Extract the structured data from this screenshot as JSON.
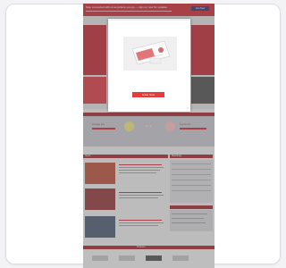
{
  "page": {
    "banner_text": "Stay connected with us anywhere you go — sign up now for updates",
    "banner_button": "Join Now",
    "modal_button": "Enter Now",
    "modal_close": "×",
    "left_team": "Chicago Fire",
    "right_team": "Toronto FC",
    "score": "2 - 1",
    "section_news": "News",
    "section_table": "Standings",
    "section_footer": "Partners"
  },
  "icons": {
    "left_crest": "crest-icon",
    "right_crest": "crest-icon",
    "close": "close-icon"
  },
  "colors": {
    "brand": "#c51d2a",
    "brand_dark": "#8f1420",
    "accent": "#1f2a66",
    "modal_button": "#e73a3a"
  }
}
